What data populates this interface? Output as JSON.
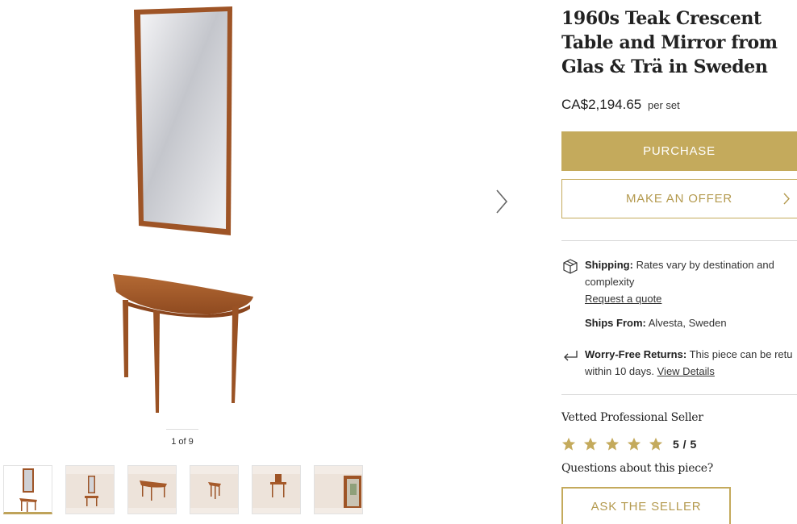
{
  "product": {
    "title": "1960s Teak Crescent Table and Mirror from Glas & Trä in Sweden",
    "price": "CA$2,194.65",
    "price_unit": "per set"
  },
  "gallery": {
    "counter": "1 of 9",
    "thumbnail_count_visible": 6,
    "current_index": 1
  },
  "actions": {
    "purchase_label": "PURCHASE",
    "offer_label": "MAKE AN OFFER",
    "ask_label": "ASK THE SELLER"
  },
  "shipping": {
    "label": "Shipping:",
    "text_line1": "Rates vary by destination and",
    "text_line2": "complexity",
    "quote_link": "Request a quote"
  },
  "ships_from": {
    "label": "Ships From:",
    "value": "Alvesta, Sweden"
  },
  "returns": {
    "label": "Worry-Free Returns:",
    "text_line1": "This piece can be retu",
    "text_line2": "within 10 days.",
    "details_link": "View Details"
  },
  "seller": {
    "label": "Vetted Professional Seller",
    "rating": "5 / 5",
    "questions": "Questions about this piece?"
  },
  "icons": {
    "next": "chevron-right-icon",
    "shipping": "package-icon",
    "returns": "return-arrow-icon",
    "star": "star-icon"
  },
  "colors": {
    "accent": "#c4aa5c",
    "accent_text": "#b49a4f",
    "teak": "#a65a2a",
    "star": "#c4aa5c"
  }
}
